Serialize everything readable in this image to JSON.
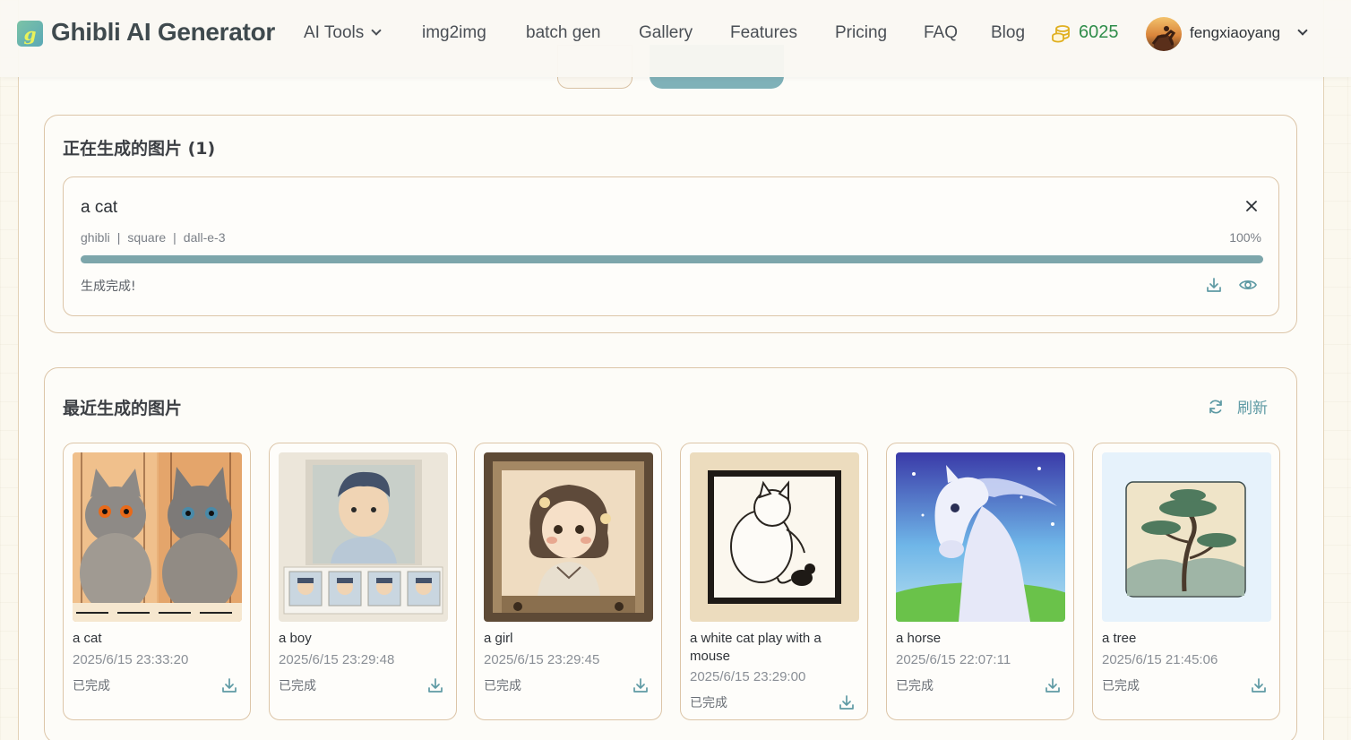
{
  "header": {
    "logo_letter": "g",
    "app_title": "Ghibli AI Generator",
    "nav": [
      "AI Tools",
      "img2img",
      "batch gen",
      "Gallery",
      "Features",
      "Pricing",
      "FAQ",
      "Blog"
    ],
    "credits": "6025",
    "username": "fengxiaoyang"
  },
  "generating": {
    "title": "正在生成的图片 (1)",
    "job": {
      "prompt": "a cat",
      "style": "ghibli",
      "size": "square",
      "model": "dall-e-3",
      "progress_label": "100%",
      "progress": 1.0,
      "status": "生成完成!"
    }
  },
  "recent": {
    "title": "最近生成的图片",
    "refresh_label": "刷新",
    "items": [
      {
        "name": "a cat",
        "time": "2025/6/15 23:33:20",
        "status": "已完成"
      },
      {
        "name": "a boy",
        "time": "2025/6/15 23:29:48",
        "status": "已完成"
      },
      {
        "name": "a girl",
        "time": "2025/6/15 23:29:45",
        "status": "已完成"
      },
      {
        "name": "a white cat play with a mouse",
        "time": "2025/6/15 23:29:00",
        "status": "已完成"
      },
      {
        "name": "a horse",
        "time": "2025/6/15 22:07:11",
        "status": "已完成"
      },
      {
        "name": "a tree",
        "time": "2025/6/15 21:45:06",
        "status": "已完成"
      }
    ]
  },
  "colors": {
    "accent": "#7da6ab",
    "credits": "#2f8d4a",
    "border": "#dcc5a8",
    "background": "#fbf8ee"
  }
}
